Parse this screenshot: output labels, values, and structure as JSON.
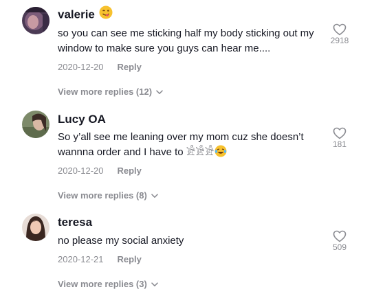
{
  "comments": [
    {
      "username": "valerie",
      "badge_icon": "yum-face-emoji-icon",
      "text": "so you can see me sticking half my body sticking out my window to make sure you guys can hear me....",
      "date": "2020-12-20",
      "reply_label": "Reply",
      "likes": "2918",
      "view_replies": "View more replies (12)"
    },
    {
      "username": "Lucy OA",
      "text": "So y’all see me leaning over my mom cuz she doesn’t wannna order and I have to 𓀀𓀀𓀀",
      "trailing_icon": "laughing-tears-emoji-icon",
      "date": "2020-12-20",
      "reply_label": "Reply",
      "likes": "181",
      "view_replies": "View more replies (8)"
    },
    {
      "username": "teresa",
      "text": "no please my social anxiety",
      "date": "2020-12-21",
      "reply_label": "Reply",
      "likes": "509",
      "view_replies": "View more replies (3)"
    }
  ],
  "colors": {
    "primary_text": "#161823",
    "secondary_text": "#8a8b91"
  }
}
